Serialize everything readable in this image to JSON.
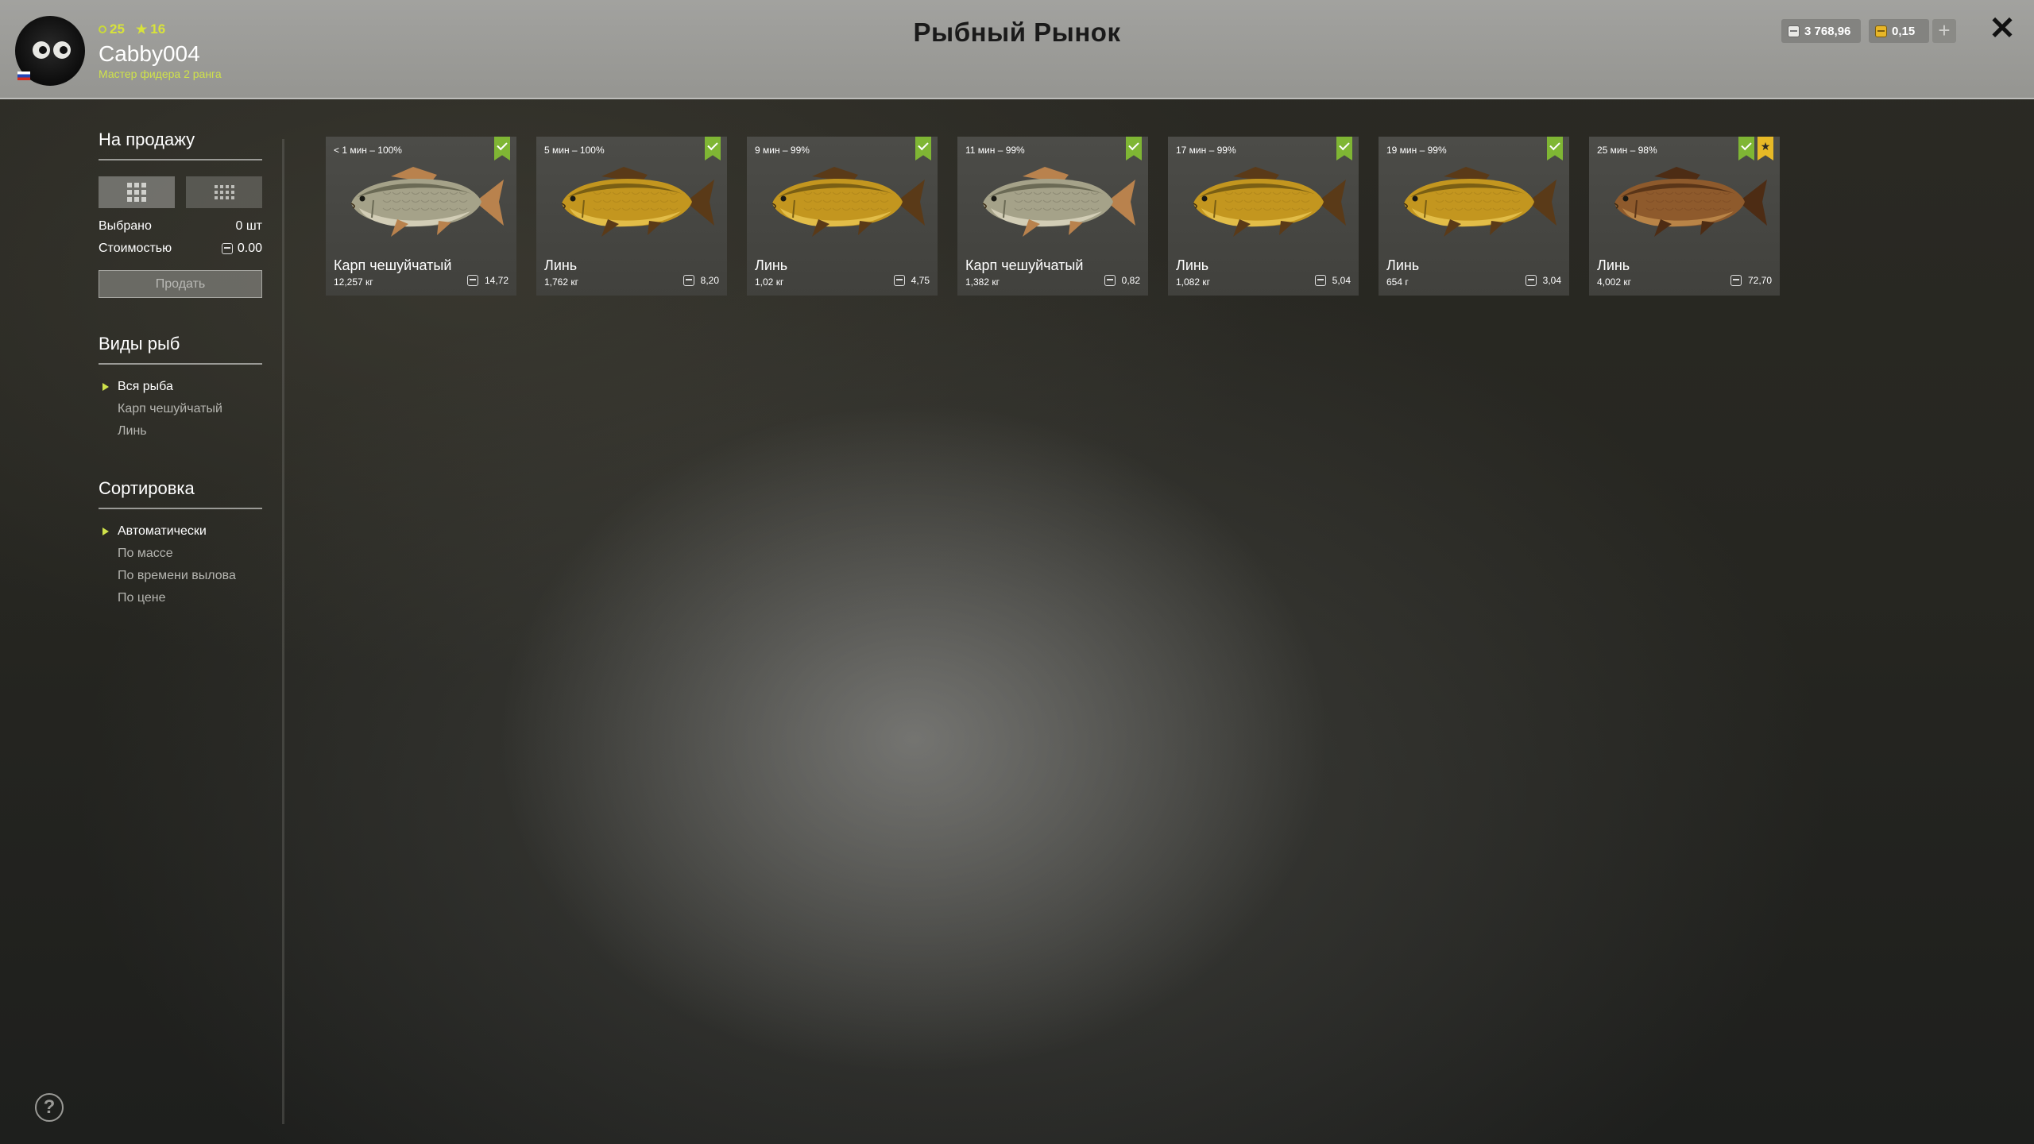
{
  "header": {
    "title": "Рыбный Рынок",
    "player": {
      "level": "25",
      "stars": "16",
      "username": "Cabby004",
      "rank": "Мастер фидера 2 ранга"
    },
    "currency": {
      "silver": "3 768,96",
      "gold": "0,15"
    },
    "add_label": "+",
    "close_label": "✕"
  },
  "sidebar": {
    "sale": {
      "title": "На продажу",
      "selected_label": "Выбрано",
      "selected_value": "0 шт",
      "cost_label": "Стоимостью",
      "cost_value": "0.00",
      "sell_button": "Продать"
    },
    "species": {
      "title": "Виды рыб",
      "items": [
        "Вся рыба",
        "Карп чешуйчатый",
        "Линь"
      ],
      "selected": 0
    },
    "sorting": {
      "title": "Сортировка",
      "items": [
        "Автоматически",
        "По массе",
        "По времени вылова",
        "По цене"
      ],
      "selected": 0
    },
    "help_label": "?"
  },
  "cards": [
    {
      "time": "< 1 мин – 100%",
      "name": "Карп чешуйчатый",
      "weight": "12,257 кг",
      "price": "14,72",
      "kind": "carp",
      "favorite": false
    },
    {
      "time": "5 мин – 100%",
      "name": "Линь",
      "weight": "1,762 кг",
      "price": "8,20",
      "kind": "tench",
      "favorite": false
    },
    {
      "time": "9 мин – 99%",
      "name": "Линь",
      "weight": "1,02 кг",
      "price": "4,75",
      "kind": "tench",
      "favorite": false
    },
    {
      "time": "11 мин – 99%",
      "name": "Карп чешуйчатый",
      "weight": "1,382 кг",
      "price": "0,82",
      "kind": "carp",
      "favorite": false
    },
    {
      "time": "17 мин – 99%",
      "name": "Линь",
      "weight": "1,082 кг",
      "price": "5,04",
      "kind": "tench",
      "favorite": false
    },
    {
      "time": "19 мин – 99%",
      "name": "Линь",
      "weight": "654 г",
      "price": "3,04",
      "kind": "tench",
      "favorite": false
    },
    {
      "time": "25 мин – 98%",
      "name": "Линь",
      "weight": "4,002 кг",
      "price": "72,70",
      "kind": "tench-dark",
      "favorite": true
    }
  ],
  "colors": {
    "accent_green": "#7fb634",
    "favorite_gold": "#e7b926",
    "rank_text": "#cfe24a"
  }
}
